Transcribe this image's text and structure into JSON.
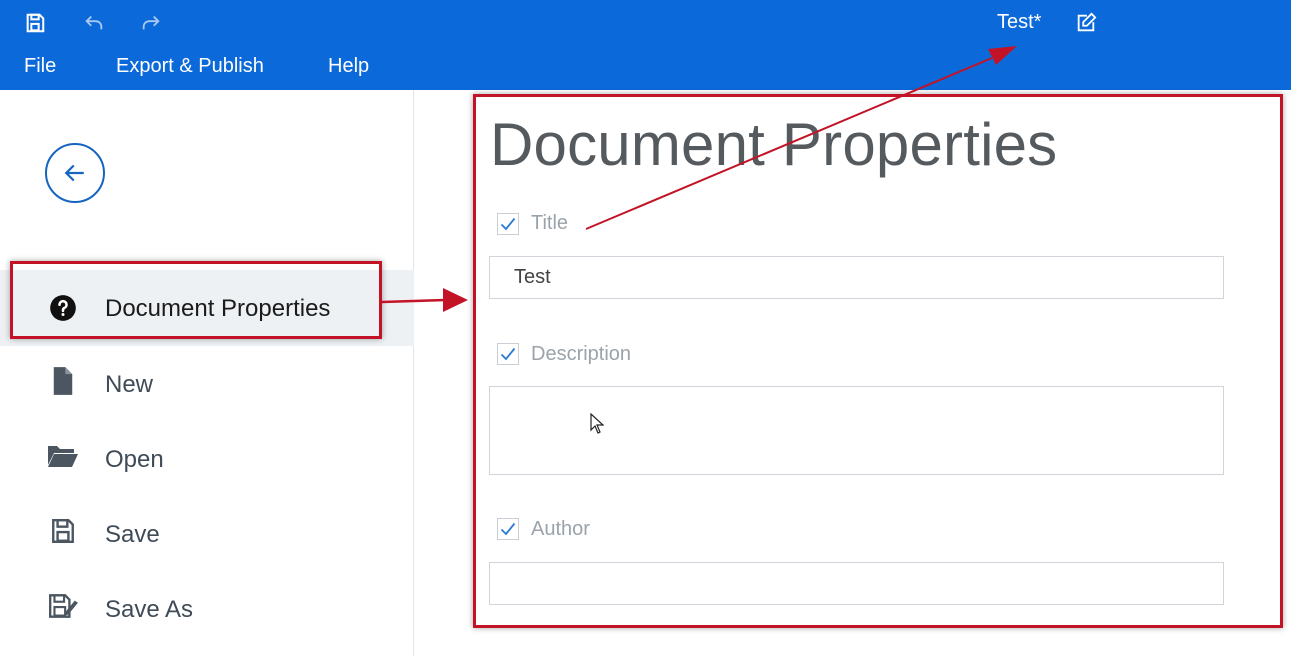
{
  "header": {
    "doc_title": "Test*",
    "quick_access": [
      "save-icon",
      "undo-icon",
      "redo-icon"
    ],
    "menu": [
      "File",
      "Export & Publish",
      "Help"
    ],
    "bg_color": "#0b69d9"
  },
  "sidebar": {
    "items": [
      {
        "label": "Document Properties",
        "icon": "question-circle-icon",
        "active": true
      },
      {
        "label": "New",
        "icon": "file-icon"
      },
      {
        "label": "Open",
        "icon": "folder-open-icon"
      },
      {
        "label": "Save",
        "icon": "save-icon"
      },
      {
        "label": "Save As",
        "icon": "save-as-icon"
      }
    ]
  },
  "main": {
    "title": "Document Properties",
    "fields": [
      {
        "label": "Title",
        "checked": true,
        "value": "Test"
      },
      {
        "label": "Description",
        "checked": true,
        "value": ""
      },
      {
        "label": "Author",
        "checked": true,
        "value": ""
      }
    ]
  },
  "annotation_color": "#c21426"
}
